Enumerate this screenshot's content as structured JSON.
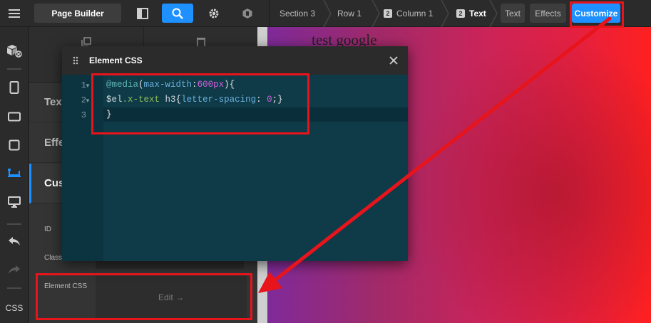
{
  "toolbar": {
    "page_builder_label": "Page Builder",
    "breadcrumbs": [
      {
        "label": "Section 3",
        "badge": ""
      },
      {
        "label": "Row 1",
        "badge": ""
      },
      {
        "label": "Column 1",
        "badge": "2"
      },
      {
        "label": "Text",
        "badge": "2"
      }
    ],
    "modes": {
      "text": "Text",
      "effects": "Effects",
      "customize": "Customize"
    }
  },
  "rail": {
    "css_label": "CSS"
  },
  "panel": {
    "sections": [
      {
        "label": "Text"
      },
      {
        "label": "Effects"
      },
      {
        "label": "Customize"
      }
    ],
    "fields": {
      "id_label": "ID",
      "class_label": "Class",
      "element_css_label": "Element CSS",
      "edit_label": "Edit →"
    }
  },
  "canvas": {
    "heading": "test google"
  },
  "modal": {
    "title": "Element CSS",
    "line_numbers": [
      "1",
      "2",
      "3"
    ],
    "code": {
      "l1_at": "@media",
      "l1_open": "(",
      "l1_prop": "max-width",
      "l1_colon": ":",
      "l1_num": "600px",
      "l1_close": "){",
      "l2_var": "$el",
      "l2_sel": ".x-text",
      "l2_tag": " h3",
      "l2_open": "{",
      "l2_prop": "letter-spacing",
      "l2_colon": ": ",
      "l2_num": "0",
      "l2_close": ";}",
      "l3": "}"
    }
  },
  "colors": {
    "accent": "#1e90ff",
    "annotation_red": "#e8141c",
    "editor_bg": "#0f3a47"
  }
}
